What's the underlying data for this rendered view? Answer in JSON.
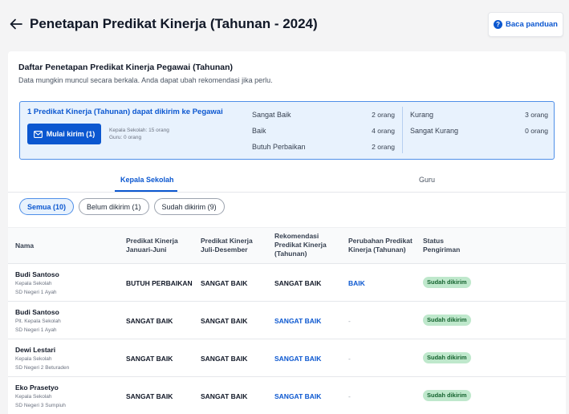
{
  "header": {
    "title": "Penetapan Predikat Kinerja (Tahunan - 2024)",
    "guide_label": "Baca panduan"
  },
  "card": {
    "title": "Daftar Penetapan Predikat Kinerja Pegawai (Tahunan)",
    "subtitle": "Data mungkin muncul secara berkala. Anda dapat ubah rekomendasi jika perlu."
  },
  "summary": {
    "headline": "1 Predikat Kinerja (Tahunan) dapat dikirim ke Pegawai",
    "send_label": "Mulai kirim (1)",
    "kepala_count": "Kepala Sekolah: 15 orang",
    "guru_count": "Guru: 0 orang",
    "col_a": [
      {
        "label": "Sangat Baik",
        "count": "2 orang"
      },
      {
        "label": "Baik",
        "count": "4 orang"
      },
      {
        "label": "Butuh Perbaikan",
        "count": "2 orang"
      }
    ],
    "col_b": [
      {
        "label": "Kurang",
        "count": "3 orang"
      },
      {
        "label": "Sangat Kurang",
        "count": "0 orang"
      }
    ]
  },
  "tabs": [
    {
      "label": "Kepala Sekolah",
      "active": true
    },
    {
      "label": "Guru",
      "active": false
    }
  ],
  "filters": [
    {
      "label": "Semua (10)",
      "active": true
    },
    {
      "label": "Belum dikirim (1)",
      "active": false
    },
    {
      "label": "Sudah dikirim (9)",
      "active": false
    }
  ],
  "table": {
    "headers": {
      "nama": "Nama",
      "c1": "Predikat Kinerja Januari-Juni",
      "c2": "Predikat Kinerja Juli-Desember",
      "c3": "Rekomendasi Predikat Kinerja (Tahunan)",
      "c4": "Perubahan Predikat Kinerja (Tahunan)",
      "c5": "Status Pengiriman"
    },
    "rows": [
      {
        "name": "Budi Santoso",
        "role": "Kepala Sekolah",
        "school": "SD Negeri 1 Ayah",
        "c1": "BUTUH PERBAIKAN",
        "c2": "SANGAT BAIK",
        "c3": "SANGAT BAIK",
        "c4": "BAIK",
        "status": "Sudah dikirim"
      },
      {
        "name": "Budi Santoso",
        "role": "Plt. Kepala Sekolah",
        "school": "SD Negeri 1 Ayah",
        "c1": "SANGAT BAIK",
        "c2": "SANGAT BAIK",
        "c3": "SANGAT BAIK",
        "c4": "-",
        "status": "Sudah dikirim"
      },
      {
        "name": "Dewi Lestari",
        "role": "Kepala Sekolah",
        "school": "SD Negeri 2 Beturaden",
        "c1": "SANGAT BAIK",
        "c2": "SANGAT BAIK",
        "c3": "SANGAT BAIK",
        "c4": "-",
        "status": "Sudah dikirim"
      },
      {
        "name": "Eko Prasetyo",
        "role": "Kepala Sekolah",
        "school": "SD Negeri 3 Sumpiuh",
        "c1": "SANGAT BAIK",
        "c2": "SANGAT BAIK",
        "c3": "SANGAT BAIK",
        "c4": "-",
        "status": "Sudah dikirim"
      }
    ]
  },
  "colors": {
    "primary": "#0b57d0",
    "summary_bg": "#e8f2fd",
    "badge_bg": "#bfe8cc",
    "badge_text": "#15632f"
  },
  "icons": {
    "back": "arrow-left-icon",
    "guide": "question-circle-icon",
    "send": "mail-icon"
  }
}
